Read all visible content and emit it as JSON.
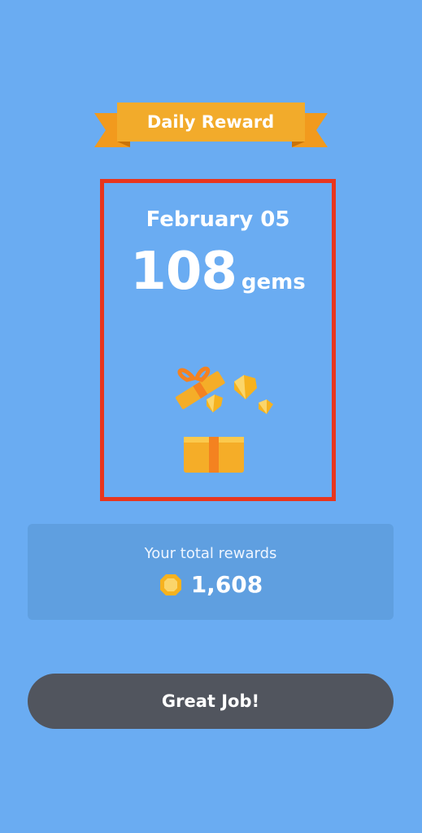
{
  "header": {
    "ribbon_label": "Daily Reward",
    "ribbon_color": "#f2ab2b"
  },
  "reward": {
    "date": "February 05",
    "amount": "108",
    "unit": "gems",
    "icon": "gift-box-icon"
  },
  "total": {
    "label": "Your total rewards",
    "value": "1,608",
    "icon": "gem-icon"
  },
  "action": {
    "button_label": "Great Job!"
  },
  "colors": {
    "background": "#6aacf2",
    "highlight_border": "#e8361e",
    "panel": "#5f9fe0",
    "button": "#51555e",
    "gem": "#f6b21f"
  }
}
